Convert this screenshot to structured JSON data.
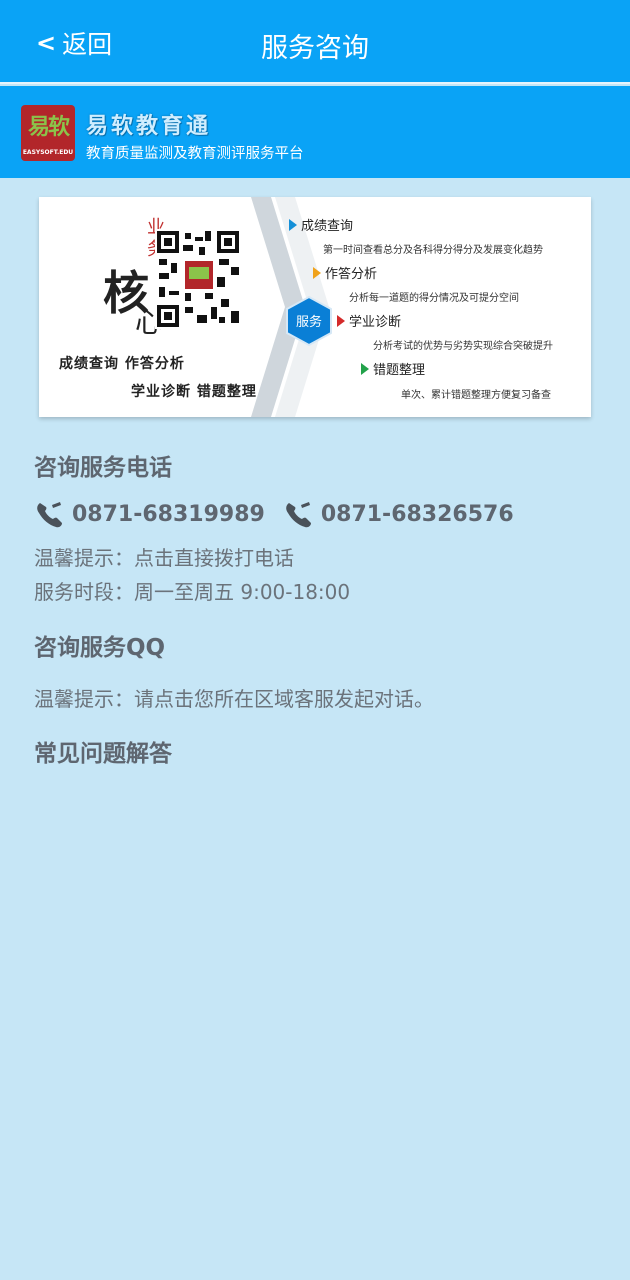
{
  "header": {
    "back_label": "返回",
    "title": "服务咨询"
  },
  "brand": {
    "logo_text": "易软",
    "logo_sub": "EASYSOFT.EDU",
    "name": "易软教育通",
    "subtitle": "教育质量监测及教育测评服务平台"
  },
  "banner": {
    "core_top": "业务",
    "core_mark": "易软",
    "core_big": "核",
    "core_small": "心",
    "tags_line1": "成绩查询  作答分析",
    "tags_line2": "学业诊断  错题整理",
    "hex_label": "服务",
    "services": [
      {
        "label": "成绩查询",
        "desc": "第一时间查看总分及各科得分得分及发展变化趋势",
        "color": "#1590d8"
      },
      {
        "label": "作答分析",
        "desc": "分析每一道题的得分情况及可提分空间",
        "color": "#f0a21a"
      },
      {
        "label": "学业诊断",
        "desc": "分析考试的优势与劣势实现综合突破提升",
        "color": "#d42a2a"
      },
      {
        "label": "错题整理",
        "desc": "单次、累计错题整理方便复习备查",
        "color": "#22a24a"
      }
    ]
  },
  "phone_section": {
    "title": "咨询服务电话",
    "numbers": [
      "0871-68319989",
      "0871-68326576"
    ],
    "tip": "温馨提示：点击直接拨打电话",
    "hours": "服务时段：周一至周五 9:00-18:00"
  },
  "qq_section": {
    "title": "咨询服务QQ",
    "tip": "温馨提示：请点击您所在区域客服发起对话。"
  },
  "faq_section": {
    "title": "常见问题解答"
  },
  "colors": {
    "header_bg": "#0aa3f6",
    "page_bg": "#c6e6f6",
    "text": "#5e6670"
  }
}
